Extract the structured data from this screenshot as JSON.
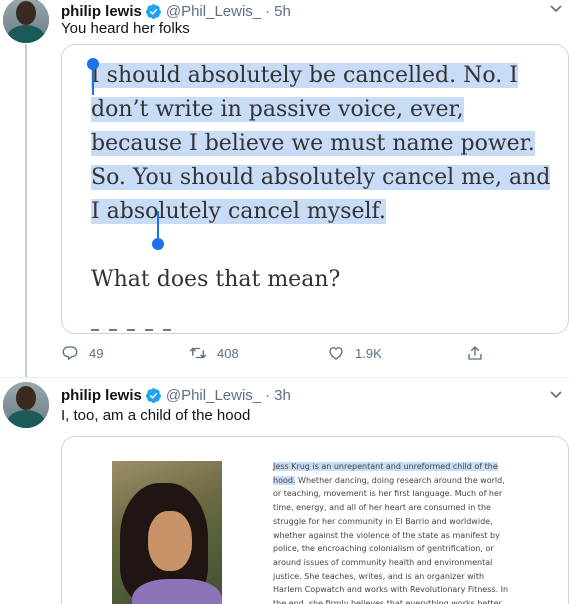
{
  "tweets": [
    {
      "author_name": "philip lewis",
      "handle": "@Phil_Lewis_",
      "dot": "·",
      "time": "5h",
      "text": "You heard her folks",
      "card": {
        "selected_text": "I should absolutely be cancelled. No. I don’t write in passive voice, ever, because I believe we must name power. So. You should absolutely cancel me, and I absolutely cancel myself.",
        "following_text": "What does that mean?"
      },
      "actions": {
        "replies": "49",
        "retweets": "408",
        "likes": "1.9K"
      }
    },
    {
      "author_name": "philip lewis",
      "handle": "@Phil_Lewis_",
      "dot": "·",
      "time": "3h",
      "text": "I, too, am a child of the hood",
      "card": {
        "bio_highlighted": "Jess Krug is an unrepentant and unreformed child of the hood.",
        "bio_rest": " Whether dancing, doing research around the world, or teaching, movement is her first language. Much of her time, energy, and all of her heart are consumed in the struggle for her community in El Barrio and worldwide, whether against the violence of the state as manifest by police, the encroaching colonialism of gentrification, or around issues of community health and environmental justice. She teaches, writes, and is an organizer with Harlem Copwatch and works with Revolutionary Fitness. In the end, she firmly believes that everything works better"
      }
    }
  ],
  "colors": {
    "verified_blue": "#1da1f2",
    "secondary_text": "#5b7083",
    "highlight": "#c8dcf7",
    "selection_handle": "#1a73e8"
  },
  "icons": [
    "verified-badge-icon",
    "chevron-down-icon",
    "reply-icon",
    "retweet-icon",
    "like-icon",
    "share-icon"
  ]
}
